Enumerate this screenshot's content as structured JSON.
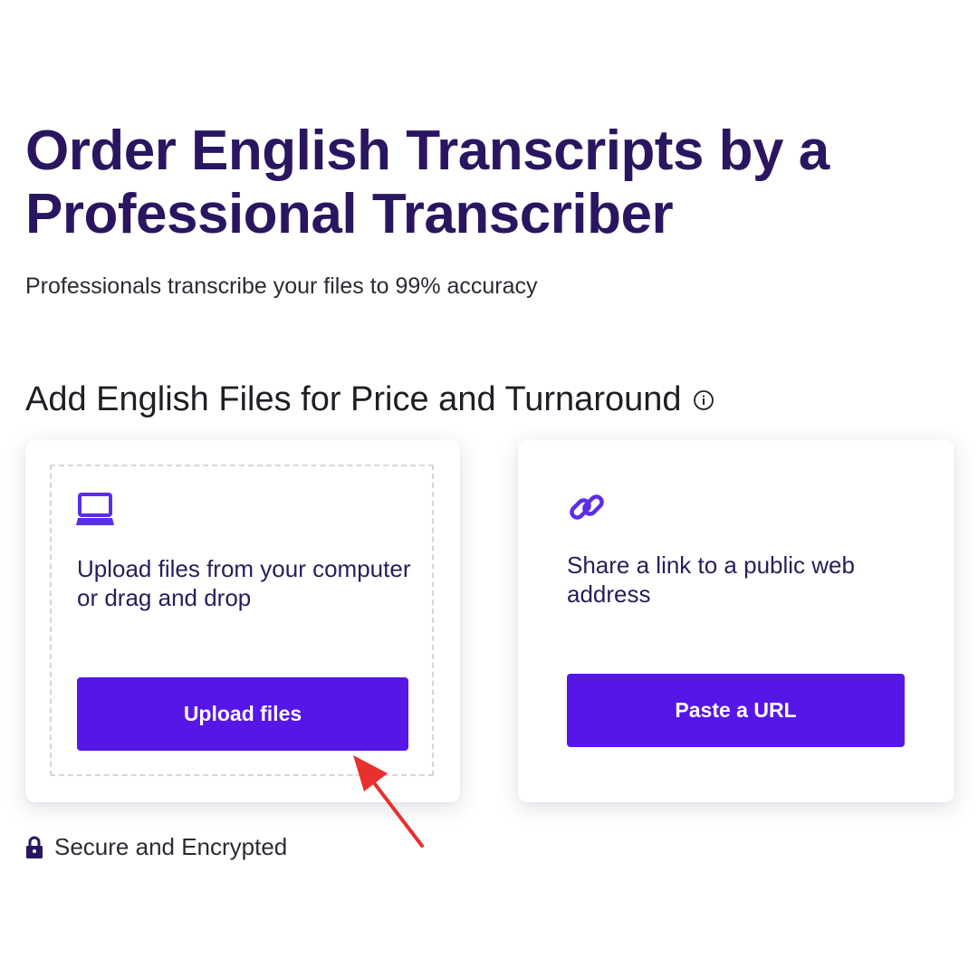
{
  "header": {
    "title": "Order English Transcripts by a Professional Transcriber",
    "subtitle": "Professionals transcribe your files to 99% accuracy"
  },
  "section": {
    "heading": "Add English Files for Price and Turnaround",
    "info_icon": "info-circle-icon"
  },
  "upload_card": {
    "icon": "laptop-icon",
    "text": "Upload files from your computer or drag and drop",
    "button_label": "Upload files"
  },
  "url_card": {
    "icon": "link-icon",
    "text": "Share a link to a public web address",
    "button_label": "Paste a URL"
  },
  "footer": {
    "icon": "lock-icon",
    "secure_label": "Secure and Encrypted"
  },
  "annotation": {
    "icon": "red-arrow-icon",
    "color": "#e8302e"
  },
  "colors": {
    "title": "#2a1660",
    "accent": "#5616e8",
    "icon": "#5b2ee6"
  }
}
